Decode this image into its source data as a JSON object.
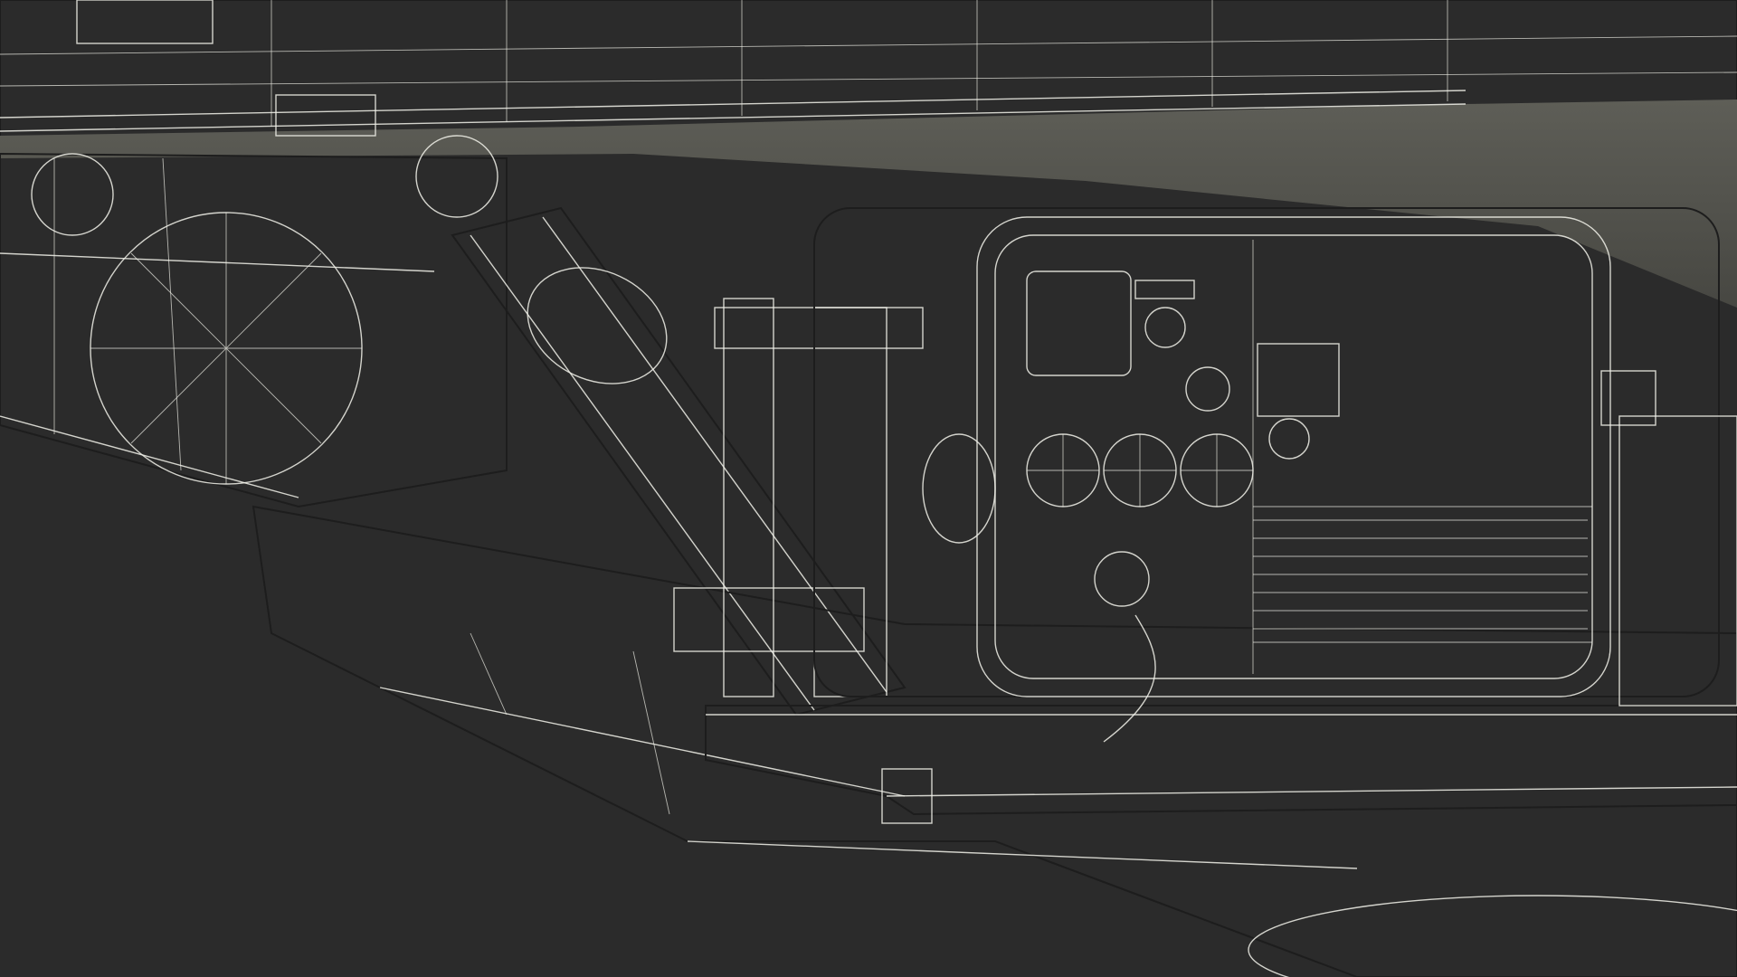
{
  "scene": {
    "subject": "wireframe-render-generator-unit",
    "background_color": "#2b2b2b",
    "mesh_color": "#f2f2ea",
    "surface_color": "#707068",
    "surface_dark_color": "#55554f"
  }
}
